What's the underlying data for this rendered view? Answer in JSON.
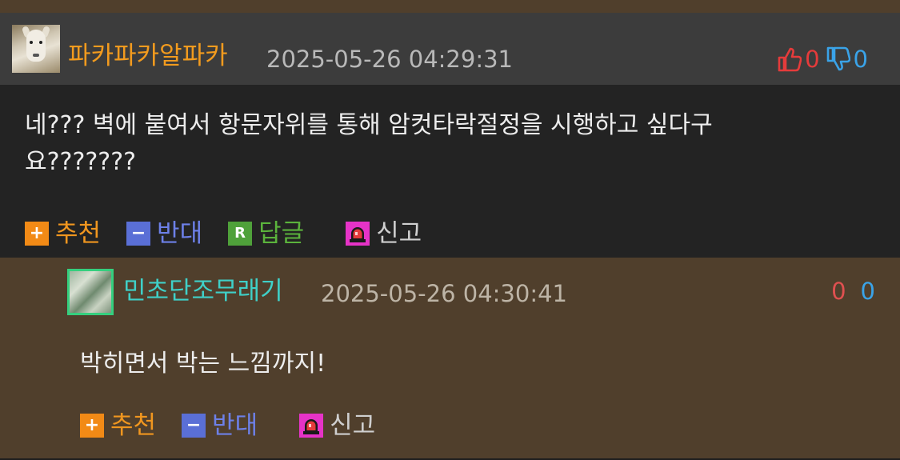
{
  "comments": [
    {
      "nickname": "파카파카알파카",
      "timestamp": "2025-05-26 04:29:31",
      "upvotes": "0",
      "downvotes": "0",
      "body_line1": "네??? 벽에 붙여서 항문자위를 통해 암컷타락절정을 시행하고 싶다구",
      "body_line2": "요???????",
      "actions": {
        "recommend_plus": "+",
        "recommend": "추천",
        "oppose_minus": "−",
        "oppose": "반대",
        "reply_badge": "R",
        "reply": "답글",
        "report": "신고"
      }
    },
    {
      "nickname": "민초단조무래기",
      "timestamp": "2025-05-26 04:30:41",
      "upvotes": "0",
      "downvotes": "0",
      "body": "박히면서 박는 느낌까지!",
      "actions": {
        "recommend_plus": "+",
        "recommend": "추천",
        "oppose_minus": "−",
        "oppose": "반대",
        "report": "신고"
      }
    }
  ],
  "icons": {
    "thumbs_up": "thumbs-up-icon",
    "thumbs_down": "thumbs-down-icon",
    "report": "siren-icon"
  },
  "colors": {
    "nickname1": "#f29b1e",
    "nickname2": "#3fd0c8",
    "upvote": "#e53b3b",
    "downvote": "#3aa3e8",
    "recommend": "#f28a16",
    "oppose": "#5a6fd6",
    "reply": "#4fa13a",
    "report": "#e633c7"
  }
}
